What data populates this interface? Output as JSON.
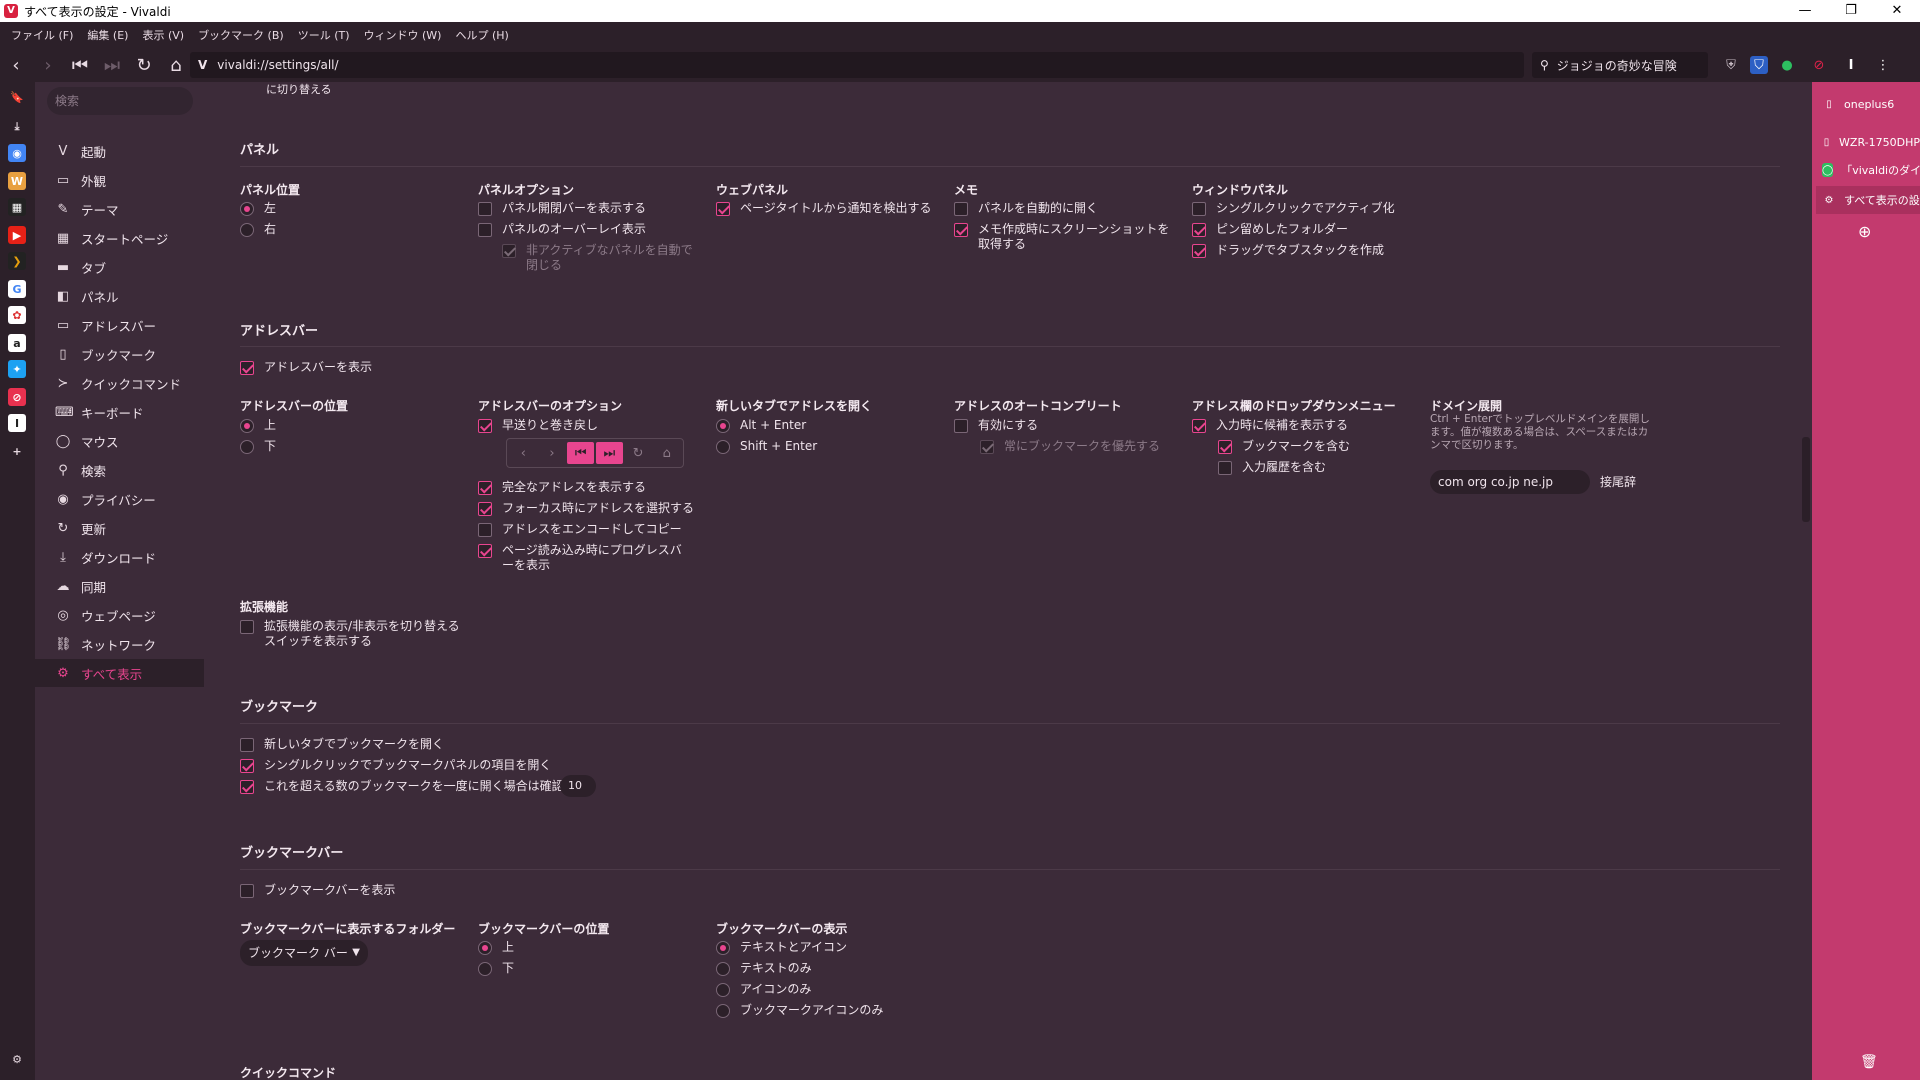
{
  "window": {
    "title": "すべて表示の設定 - Vivaldi",
    "logo": "V"
  },
  "window_controls": {
    "minimize": "—",
    "restore": "❐",
    "close": "✕"
  },
  "menu": [
    "ファイル (F)",
    "編集 (E)",
    "表示 (V)",
    "ブックマーク (B)",
    "ツール (T)",
    "ウィンドウ (W)",
    "ヘルプ (H)"
  ],
  "address": {
    "url": "vivaldi://settings/all/",
    "vmark": "V",
    "search": "ジョジョの奇妙な冒険"
  },
  "nav": {
    "search_placeholder": "検索",
    "items": [
      "起動",
      "外観",
      "テーマ",
      "スタートページ",
      "タブ",
      "パネル",
      "アドレスバー",
      "ブックマーク",
      "クイックコマンド",
      "キーボード",
      "マウス",
      "検索",
      "プライバシー",
      "更新",
      "ダウンロード",
      "同期",
      "ウェブページ",
      "ネットワーク",
      "すべて表示"
    ]
  },
  "partial_top": "に切り替える",
  "panel": {
    "heading": "パネル",
    "position": {
      "title": "パネル位置",
      "left": "左",
      "right": "右",
      "selected": "左"
    },
    "options": {
      "title": "パネルオプション",
      "show_toggle": "パネル開閉バーを表示する",
      "overlay": "パネルのオーバーレイ表示",
      "auto_close": "非アクティブなパネルを自動で閉じる"
    },
    "web": {
      "title": "ウェブパネル",
      "detect": "ページタイトルから通知を検出する"
    },
    "memo": {
      "title": "メモ",
      "auto_open": "パネルを自動的に開く",
      "screenshot": "メモ作成時にスクリーンショットを取得する"
    },
    "window": {
      "title": "ウィンドウパネル",
      "single_click": "シングルクリックでアクティブ化",
      "pinned": "ピン留めしたフォルダー",
      "drag": "ドラッグでタブスタックを作成"
    }
  },
  "addressbar": {
    "heading": "アドレスバー",
    "show": "アドレスバーを表示",
    "position": {
      "title": "アドレスバーの位置",
      "top": "上",
      "bottom": "下"
    },
    "options": {
      "title": "アドレスバーのオプション",
      "fastforward": "早送りと巻き戻し",
      "full": "完全なアドレスを表示する",
      "select": "フォーカス時にアドレスを選択する",
      "encode": "アドレスをエンコードしてコピー",
      "progress": "ページ読み込み時にプログレスバーを表示"
    },
    "newtab": {
      "title": "新しいタブでアドレスを開く",
      "alt": "Alt + Enter",
      "shift": "Shift + Enter"
    },
    "autocomplete": {
      "title": "アドレスのオートコンプリート",
      "enable": "有効にする",
      "prefer": "常にブックマークを優先する"
    },
    "dropdown": {
      "title": "アドレス欄のドロップダウンメニュー",
      "show": "入力時に候補を表示する",
      "bookmarks": "ブックマークを含む",
      "history": "入力履歴を含む"
    },
    "domain": {
      "title": "ドメイン展開",
      "desc": "Ctrl + Enterでトップレベルドメインを展開します。値が複数ある場合は、スペースまたはカンマで区切ります。",
      "value": "com org co.jp ne.jp",
      "suffix_label": "接尾辞"
    }
  },
  "extensions": {
    "heading": "拡張機能",
    "toggle": "拡張機能の表示/非表示を切り替えるスイッチを表示する"
  },
  "bookmarks": {
    "heading": "ブックマーク",
    "newtab": "新しいタブでブックマークを開く",
    "single": "シングルクリックでブックマークパネルの項目を開く",
    "confirm": "これを超える数のブックマークを一度に開く場合は確認する",
    "confirm_count": "10"
  },
  "bookmarkbar": {
    "heading": "ブックマークバー",
    "show": "ブックマークバーを表示",
    "folder": {
      "title": "ブックマークバーに表示するフォルダー",
      "value": "ブックマーク バー"
    },
    "position": {
      "title": "ブックマークバーの位置",
      "top": "上",
      "bottom": "下"
    },
    "display": {
      "title": "ブックマークバーの表示",
      "text_icon": "テキストとアイコン",
      "text": "テキストのみ",
      "icon": "アイコンのみ",
      "bm_icon": "ブックマークアイコンのみ"
    }
  },
  "partial_bottom": "クイックコマンド",
  "tabs": [
    "oneplus6",
    "WZR-1750DHP",
    "「vivaldiのダイレ",
    "すべて表示の設"
  ],
  "colors": {
    "accent": "#e8458f",
    "panel_bg": "#c33a6e",
    "bg": "#3c2b39"
  }
}
